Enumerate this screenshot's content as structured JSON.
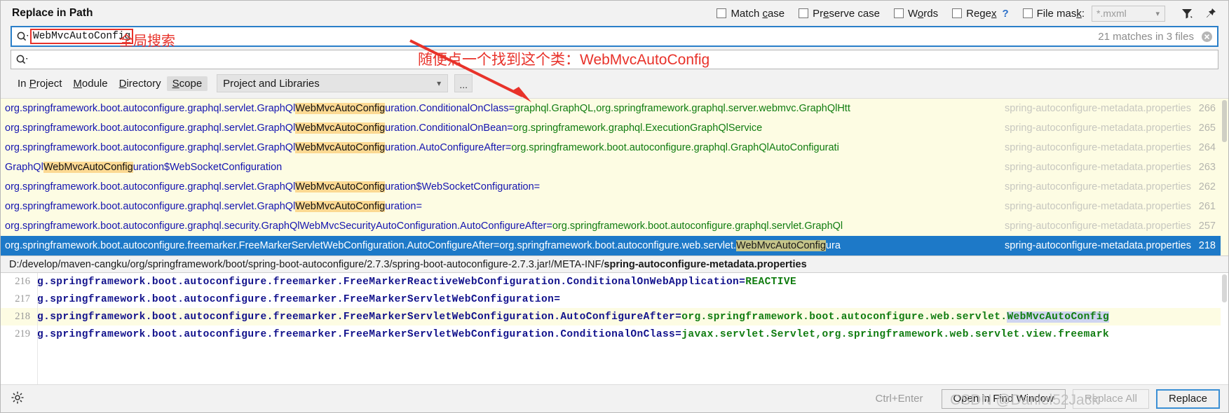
{
  "dialog": {
    "title": "Replace in Path"
  },
  "options": {
    "match_case": {
      "label_pre": "Match ",
      "mnemonic": "c",
      "label_post": "ase",
      "checked": false
    },
    "preserve_case": {
      "label_pre": "Pr",
      "mnemonic": "e",
      "label_post": "serve case",
      "checked": false
    },
    "words": {
      "label_pre": "W",
      "mnemonic": "o",
      "label_post": "rds",
      "checked": false
    },
    "regex": {
      "label_pre": "Rege",
      "mnemonic": "x",
      "label_post": "",
      "help": "?",
      "checked": false
    },
    "file_mask": {
      "label_pre": "File mas",
      "mnemonic": "k",
      "label_post": ":",
      "checked": false,
      "value": "*.mxml"
    }
  },
  "header_icons": {
    "filter": "filter-icon",
    "pin": "pin-icon"
  },
  "search": {
    "value": "WebMvcAutoConfig",
    "magnifier_icon": "search-icon",
    "match_count": "21 matches in 3 files",
    "clear_icon": "clear-icon"
  },
  "replace": {
    "value": "",
    "magnifier_icon": "search-icon"
  },
  "scope": {
    "tabs": [
      {
        "label": "In Project",
        "pre": "In ",
        "mnemonic": "P",
        "post": "roject",
        "selected": false
      },
      {
        "label": "Module",
        "pre": "",
        "mnemonic": "M",
        "post": "odule",
        "selected": false
      },
      {
        "label": "Directory",
        "pre": "",
        "mnemonic": "D",
        "post": "irectory",
        "selected": false
      },
      {
        "label": "Scope",
        "pre": "",
        "mnemonic": "S",
        "post": "cope",
        "selected": true
      }
    ],
    "combo_value": "Project and Libraries",
    "ellipsis_button": "..."
  },
  "results": [
    {
      "selected": true,
      "segments": [
        {
          "t": "org.springframework.boot.autoconfigure.freemarker.FreeMarkerServletWebConfiguration.AutoConfigureAfter=",
          "c": "blue"
        },
        {
          "t": "org.springframework.boot.autoconfigure.web.servlet.",
          "c": "green"
        },
        {
          "t": "WebMvcAutoConfig",
          "c": "hl"
        },
        {
          "t": "ura",
          "c": "green"
        }
      ],
      "file": "spring-autoconfigure-metadata.properties",
      "line": "218"
    },
    {
      "selected": false,
      "segments": [
        {
          "t": "org.springframework.boot.autoconfigure.graphql.security.GraphQlWebMvcSecurityAutoConfiguration.AutoConfigureAfter=",
          "c": "blue"
        },
        {
          "t": "org.springframework.boot.autoconfigure.graphql.servlet.GraphQl",
          "c": "green"
        }
      ],
      "file": "spring-autoconfigure-metadata.properties",
      "line": "257"
    },
    {
      "selected": false,
      "segments": [
        {
          "t": "org.springframework.boot.autoconfigure.graphql.servlet.GraphQl",
          "c": "blue"
        },
        {
          "t": "WebMvcAutoConfig",
          "c": "hl"
        },
        {
          "t": "uration=",
          "c": "blue"
        }
      ],
      "file": "spring-autoconfigure-metadata.properties",
      "line": "261"
    },
    {
      "selected": false,
      "segments": [
        {
          "t": "org.springframework.boot.autoconfigure.graphql.servlet.GraphQl",
          "c": "blue"
        },
        {
          "t": "WebMvcAutoConfig",
          "c": "hl"
        },
        {
          "t": "uration$WebSocketConfiguration=",
          "c": "blue"
        }
      ],
      "file": "spring-autoconfigure-metadata.properties",
      "line": "262"
    },
    {
      "selected": false,
      "segments": [
        {
          "t": "GraphQl",
          "c": "blue"
        },
        {
          "t": "WebMvcAutoConfig",
          "c": "hl"
        },
        {
          "t": "uration$WebSocketConfiguration",
          "c": "blue"
        }
      ],
      "file": "spring-autoconfigure-metadata.properties",
      "line": "263"
    },
    {
      "selected": false,
      "segments": [
        {
          "t": "org.springframework.boot.autoconfigure.graphql.servlet.GraphQl",
          "c": "blue"
        },
        {
          "t": "WebMvcAutoConfig",
          "c": "hl"
        },
        {
          "t": "uration.AutoConfigureAfter=",
          "c": "blue"
        },
        {
          "t": "org.springframework.boot.autoconfigure.graphql.GraphQlAutoConfigurati",
          "c": "green"
        }
      ],
      "file": "spring-autoconfigure-metadata.properties",
      "line": "264"
    },
    {
      "selected": false,
      "segments": [
        {
          "t": "org.springframework.boot.autoconfigure.graphql.servlet.GraphQl",
          "c": "blue"
        },
        {
          "t": "WebMvcAutoConfig",
          "c": "hl"
        },
        {
          "t": "uration.ConditionalOnBean=",
          "c": "blue"
        },
        {
          "t": "org.springframework.graphql.ExecutionGraphQlService",
          "c": "green"
        }
      ],
      "file": "spring-autoconfigure-metadata.properties",
      "line": "265"
    },
    {
      "selected": false,
      "segments": [
        {
          "t": "org.springframework.boot.autoconfigure.graphql.servlet.GraphQl",
          "c": "blue"
        },
        {
          "t": "WebMvcAutoConfig",
          "c": "hl"
        },
        {
          "t": "uration.ConditionalOnClass=",
          "c": "blue"
        },
        {
          "t": "graphql.GraphQL,org.springframework.graphql.server.webmvc.GraphQlHtt",
          "c": "green"
        }
      ],
      "file": "spring-autoconfigure-metadata.properties",
      "line": "266"
    }
  ],
  "path_bar": {
    "prefix": "D:/develop/maven-cangku/org/springframework/boot/spring-boot-autoconfigure/2.7.3/spring-boot-autoconfigure-2.7.3.jar!/META-INF/",
    "filename": "spring-autoconfigure-metadata.properties"
  },
  "preview": [
    {
      "line": "216",
      "hit": false,
      "segments": [
        {
          "t": "g.springframework.boot.autoconfigure.freemarker.FreeMarkerReactiveWebConfiguration.ConditionalOnWebApplication=",
          "c": "blue"
        },
        {
          "t": "REACTIVE",
          "c": "green"
        }
      ]
    },
    {
      "line": "217",
      "hit": false,
      "segments": [
        {
          "t": "g.springframework.boot.autoconfigure.freemarker.FreeMarkerServletWebConfiguration=",
          "c": "blue"
        }
      ]
    },
    {
      "line": "218",
      "hit": true,
      "segments": [
        {
          "t": "g.springframework.boot.autoconfigure.freemarker.FreeMarkerServletWebConfiguration.AutoConfigureAfter=",
          "c": "blue"
        },
        {
          "t": "org.springframework.boot.autoconfigure.web.servlet.",
          "c": "green"
        },
        {
          "t": "WebMvcAutoConfig",
          "c": "greenhl"
        }
      ]
    },
    {
      "line": "219",
      "hit": false,
      "segments": [
        {
          "t": "g.springframework.boot.autoconfigure.freemarker.FreeMarkerServletWebConfiguration.ConditionalOnClass=",
          "c": "blue"
        },
        {
          "t": "javax.servlet.Servlet,org.springframework.web.servlet.view.freemark",
          "c": "green"
        }
      ]
    }
  ],
  "bottom": {
    "settings_icon": "gear-icon",
    "shortcut": "Ctrl+Enter",
    "open_in_find_window": "Open in Find Window",
    "replace_all": "Replace All",
    "replace": "Replace"
  },
  "annotations": {
    "search_label": "全局搜索",
    "arrow_note": "随便点一个找到这个类：WebMvcAutoConfig",
    "watermark": "CSDN @Daniel52Jack",
    "arrow_color": "#e8322a"
  }
}
